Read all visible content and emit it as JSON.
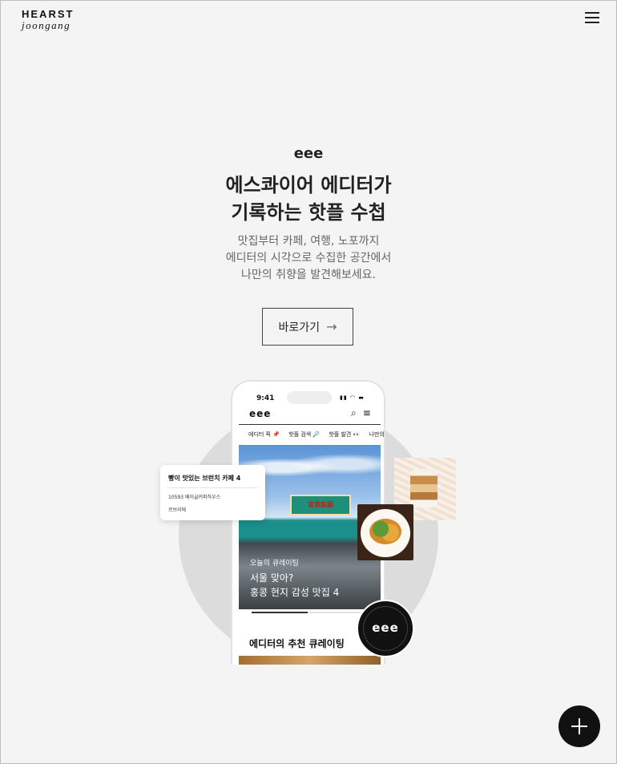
{
  "header": {
    "logo_line1": "HEARST",
    "logo_line2": "joongang",
    "menu_icon": "hamburger-icon"
  },
  "hero": {
    "brand": "eee",
    "headline_line1": "에스콰이어 에디터가",
    "headline_line2": "기록하는 핫플 수첩",
    "desc_line1": "맛집부터 카페, 여행, 노포까지",
    "desc_line2": "에디터의 시각으로 수집한 공간에서",
    "desc_line3": "나만의 취향을 발견해보세요.",
    "cta_label": "바로가기",
    "cta_icon": "arrow-right-icon"
  },
  "phone": {
    "time": "9:41",
    "app_logo": "eee",
    "nav": [
      "에디터 픽 📌",
      "핫플 검색 🔎",
      "핫플 발견 👀",
      "나만의"
    ],
    "hero_caption_small": "오늘의 큐레이팅",
    "hero_caption_line1": "서울 맞아?",
    "hero_caption_line2": "홍콩 현지 감성 맛집 4",
    "section_title": "에디터의 추천 큐레이팅"
  },
  "floating_card": {
    "title": "빵이 맛있는 브런치 카페 4",
    "item1": "10593 베이글커피하우스",
    "item2": "르브리에"
  },
  "badge": {
    "text": "eee"
  },
  "fab": {
    "icon": "plus-icon"
  },
  "colors": {
    "background": "#f4f4f4",
    "text": "#222222",
    "fab": "#111111"
  }
}
